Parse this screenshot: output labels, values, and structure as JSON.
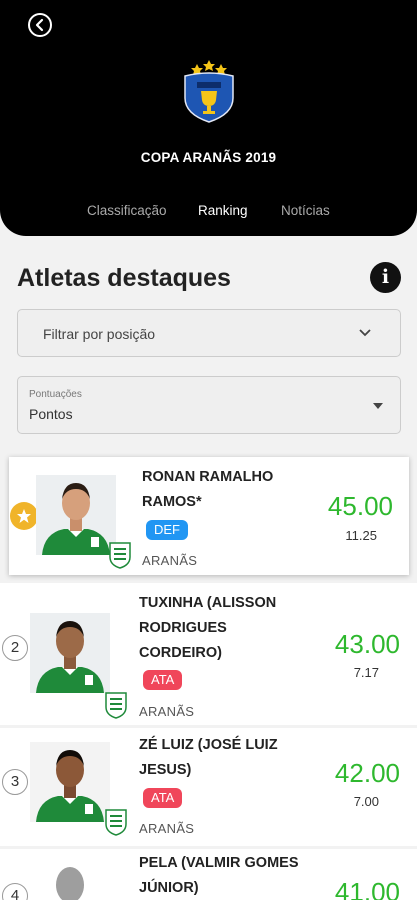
{
  "header": {
    "title": "COPA ARANÃS 2019",
    "tabs": [
      {
        "label": "Classificação"
      },
      {
        "label": "Ranking"
      },
      {
        "label": "Notícias"
      }
    ]
  },
  "section": {
    "title": "Atletas destaques",
    "info_icon": "i"
  },
  "filter": {
    "label": "Filtrar por posição"
  },
  "select": {
    "label": "Pontuações",
    "value": "Pontos"
  },
  "athletes": [
    {
      "rank": "",
      "name_lines": [
        "RONAN RAMALHO",
        "RAMOS*"
      ],
      "position": "DEF",
      "club": "ARANÃS",
      "points": "45.00",
      "average": "11.25"
    },
    {
      "rank": "2",
      "name_lines": [
        "TUXINHA (ALISSON",
        "RODRIGUES",
        "CORDEIRO)"
      ],
      "position": "ATA",
      "club": "ARANÃS",
      "points": "43.00",
      "average": "7.17"
    },
    {
      "rank": "3",
      "name_lines": [
        "ZÉ LUIZ (JOSÉ LUIZ",
        "JESUS)"
      ],
      "position": "ATA",
      "club": "ARANÃS",
      "points": "42.00",
      "average": "7.00"
    },
    {
      "rank": "4",
      "name_lines": [
        "PELA (VALMIR GOMES",
        "JÚNIOR)"
      ],
      "position": "",
      "club": "",
      "points": "41.00",
      "average": ""
    }
  ],
  "colors": {
    "header_bg": "#000000",
    "points_green": "#2eb82e",
    "def_badge": "#2196f3",
    "ata_badge": "#f0465a",
    "star_badge": "#f0b42a",
    "jersey_green": "#1f8a3a"
  },
  "icons": [
    "back-arrow-icon",
    "league-shield-logo",
    "info-icon",
    "chevron-down-icon",
    "caret-down-icon",
    "star-icon",
    "club-crest-icon"
  ]
}
